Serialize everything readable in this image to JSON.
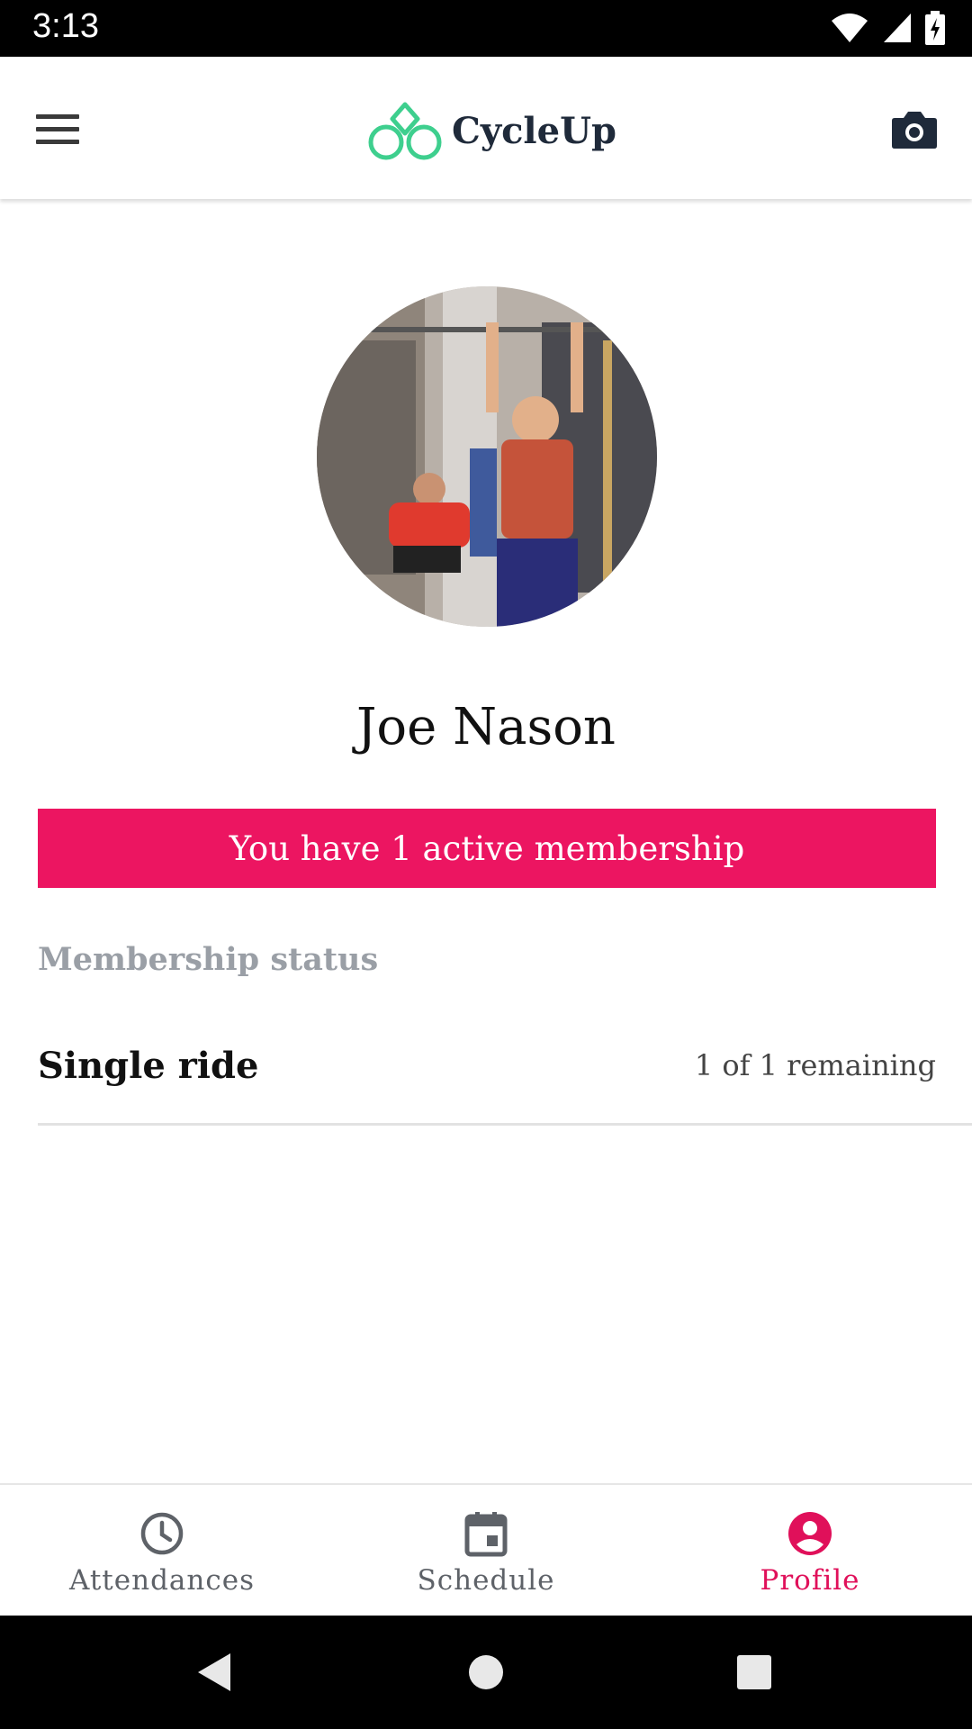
{
  "status_bar": {
    "time": "3:13"
  },
  "app_bar": {
    "title": "CycleUp"
  },
  "profile": {
    "name": "Joe Nason"
  },
  "banner": {
    "text": "You have 1 active membership"
  },
  "membership": {
    "section_label": "Membership status",
    "items": [
      {
        "name": "Single ride",
        "remaining": "1 of 1 remaining"
      }
    ]
  },
  "bottom_nav": {
    "items": [
      {
        "label": "Attendances",
        "icon": "clock-icon"
      },
      {
        "label": "Schedule",
        "icon": "calendar-icon"
      },
      {
        "label": "Profile",
        "icon": "account-circle-icon",
        "active": true
      }
    ]
  },
  "colors": {
    "accent": "#ec1561",
    "logo_green": "#3ecf8e",
    "dark": "#1f2a3a"
  }
}
